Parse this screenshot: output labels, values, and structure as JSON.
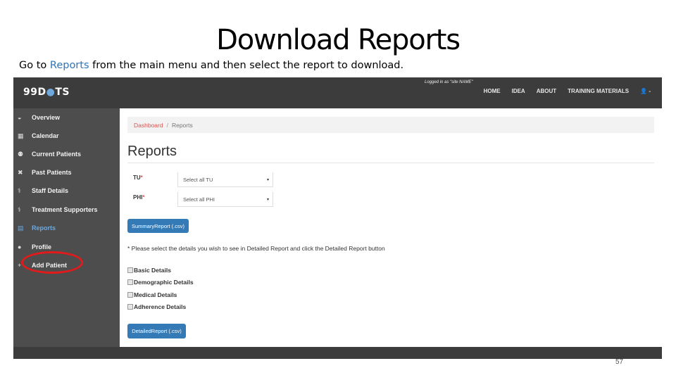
{
  "slide": {
    "title": "Download Reports",
    "subtitle_pre": "Go to ",
    "subtitle_kw": "Reports",
    "subtitle_post": " from the main menu and then select the report to download.",
    "page_number": "57"
  },
  "app": {
    "logo_pre": "99D",
    "logo_dots": "●",
    "logo_post": "TS",
    "logged_in_text": "Logged in as \"site NAME\"",
    "nav": [
      "HOME",
      "IDEA",
      "ABOUT",
      "TRAINING MATERIALS",
      "👤 -"
    ],
    "sidebar": [
      {
        "icon": "◒",
        "label": "Overview"
      },
      {
        "icon": "▦",
        "label": "Calendar"
      },
      {
        "icon": "⚉",
        "label": "Current Patients"
      },
      {
        "icon": "✖",
        "label": "Past Patients"
      },
      {
        "icon": "⚕",
        "label": "Staff Details"
      },
      {
        "icon": "⚕",
        "label": "Treatment Supporters"
      },
      {
        "icon": "▤",
        "label": "Reports"
      },
      {
        "icon": "●",
        "label": "Profile"
      },
      {
        "icon": "+",
        "label": "Add Patient"
      }
    ],
    "breadcrumb": {
      "first": "Dashboard",
      "sep": "/",
      "second": "Reports"
    },
    "page_heading": "Reports",
    "fields": {
      "tu_label": "TU",
      "tu_req": "*",
      "tu_value": "Select all TU",
      "phi_label": "PHI",
      "phi_req": "*",
      "phi_value": "Select all PHI",
      "caret": "▾"
    },
    "summary_button": "SummaryReport (.csv)",
    "note": "* Please select the details you wish to see in Detailed Report and click the Detailed Report button",
    "checkboxes": [
      "Basic Details",
      "Demographic Details",
      "Medical Details",
      "Adherence Details"
    ],
    "detailed_button": "DetailedReport (.csv)"
  }
}
